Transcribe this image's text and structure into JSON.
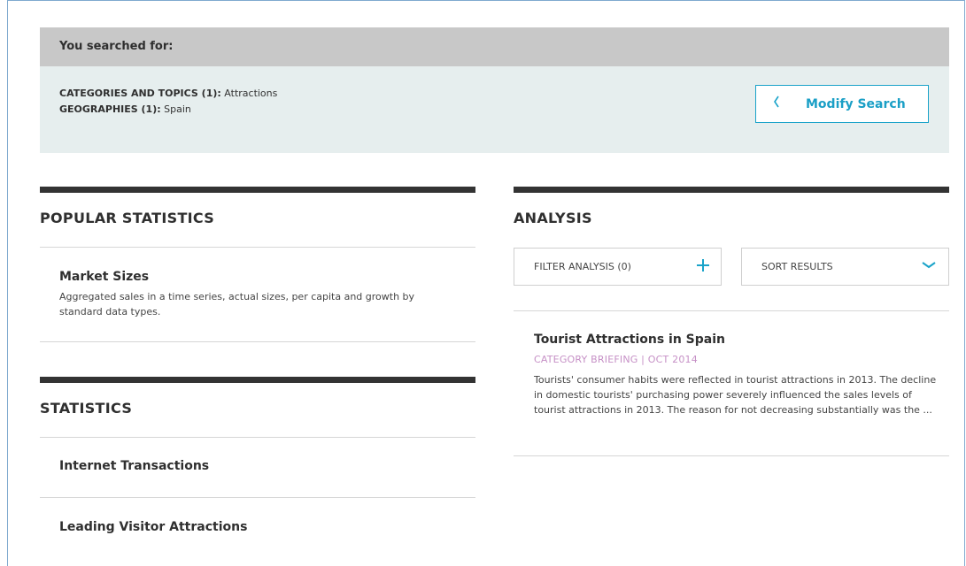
{
  "search": {
    "header": "You searched for:",
    "categories_label": "CATEGORIES AND TOPICS (1):",
    "categories_value": "Attractions",
    "geographies_label": "GEOGRAPHIES (1):",
    "geographies_value": "Spain",
    "modify_label": "Modify Search",
    "modify_icon": "chevron-left-icon"
  },
  "popular": {
    "heading": "POPULAR STATISTICS",
    "items": [
      {
        "title": "Market Sizes",
        "description": "Aggregated sales in a time series, actual sizes, per capita and growth by standard data types."
      }
    ]
  },
  "statistics": {
    "heading": "STATISTICS",
    "items": [
      {
        "title": "Internet Transactions"
      },
      {
        "title": "Leading Visitor Attractions"
      }
    ]
  },
  "analysis": {
    "heading": "ANALYSIS",
    "filter_label": "FILTER ANALYSIS (0)",
    "filter_icon": "plus-icon",
    "sort_label": "SORT RESULTS",
    "sort_icon": "chevron-down-icon",
    "results": [
      {
        "title": "Tourist Attractions in Spain",
        "meta": "CATEGORY BRIEFING | OCT 2014",
        "snippet": "Tourists' consumer habits were reflected in tourist attractions in 2013. The decline in domestic tourists' purchasing power severely influenced the sales levels of tourist attractions in 2013. The reason for not decreasing substantially was the ..."
      }
    ]
  },
  "colors": {
    "accent": "#1aa3c9",
    "meta": "#c690c6",
    "panel": "#e6eeee",
    "panel_header": "#c8c8c8"
  }
}
